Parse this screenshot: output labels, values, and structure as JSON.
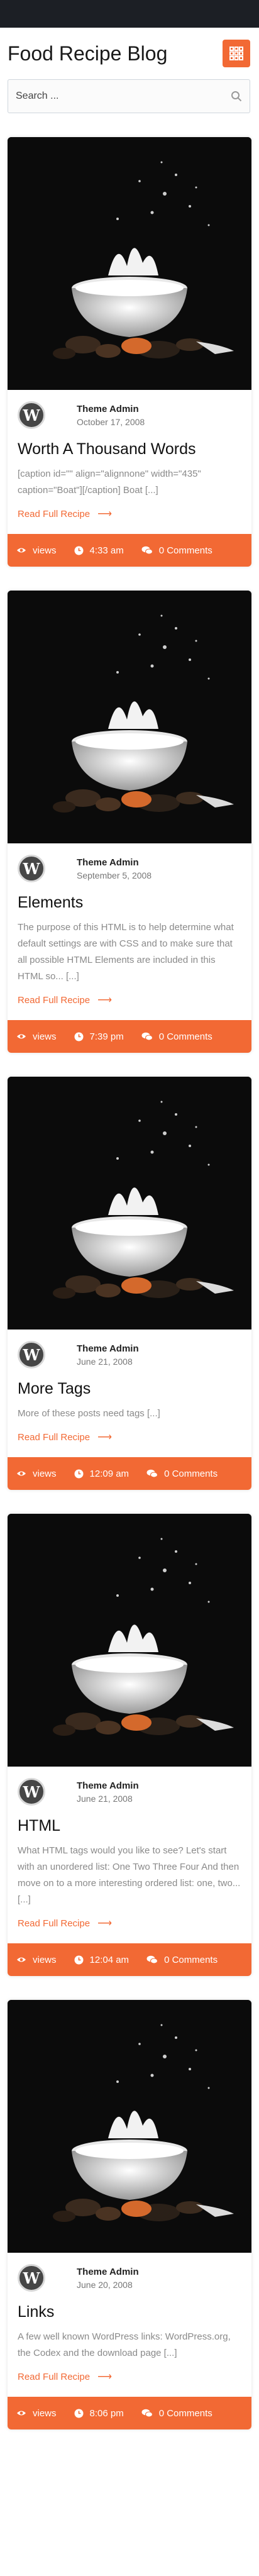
{
  "site": {
    "title": "Food Recipe Blog"
  },
  "search": {
    "placeholder": "Search ..."
  },
  "posts": [
    {
      "author": "Theme Admin",
      "date": "October 17, 2008",
      "title": "Worth A Thousand Words",
      "excerpt": "[caption id=\"\" align=\"alignnone\" width=\"435\" caption=\"Boat\"][/caption] Boat [...]",
      "read_more": "Read Full Recipe",
      "views": "views",
      "time": "4:33 am",
      "comments": "0 Comments"
    },
    {
      "author": "Theme Admin",
      "date": "September 5, 2008",
      "title": "Elements",
      "excerpt": "The purpose of this HTML is to help determine what default settings are with CSS and to make sure that all possible HTML Elements are included in this HTML so... [...]",
      "read_more": "Read Full Recipe",
      "views": "views",
      "time": "7:39 pm",
      "comments": "0 Comments"
    },
    {
      "author": "Theme Admin",
      "date": "June 21, 2008",
      "title": "More Tags",
      "excerpt": "More of these posts need tags [...]",
      "read_more": "Read Full Recipe",
      "views": "views",
      "time": "12:09 am",
      "comments": "0 Comments"
    },
    {
      "author": "Theme Admin",
      "date": "June 21, 2008",
      "title": "HTML",
      "excerpt": "What HTML tags would you like to see? Let's start with an unordered list: One Two Three Four And then move on to a more interesting ordered list: one, two... [...]",
      "read_more": "Read Full Recipe",
      "views": "views",
      "time": "12:04 am",
      "comments": "0 Comments"
    },
    {
      "author": "Theme Admin",
      "date": "June 20, 2008",
      "title": "Links",
      "excerpt": "A few well known WordPress links: WordPress.org, the Codex and the download page [...]",
      "read_more": "Read Full Recipe",
      "views": "views",
      "time": "8:06 pm",
      "comments": "0 Comments"
    }
  ],
  "colors": {
    "accent": "#f26934",
    "topbar": "#1c1f25"
  },
  "icons": {
    "menu": "grid-icon",
    "search": "search-icon",
    "views": "eye-icon",
    "time": "clock-icon",
    "comments": "comments-icon",
    "avatar": "wordpress-icon",
    "read_more": "arrow-right-icon"
  }
}
